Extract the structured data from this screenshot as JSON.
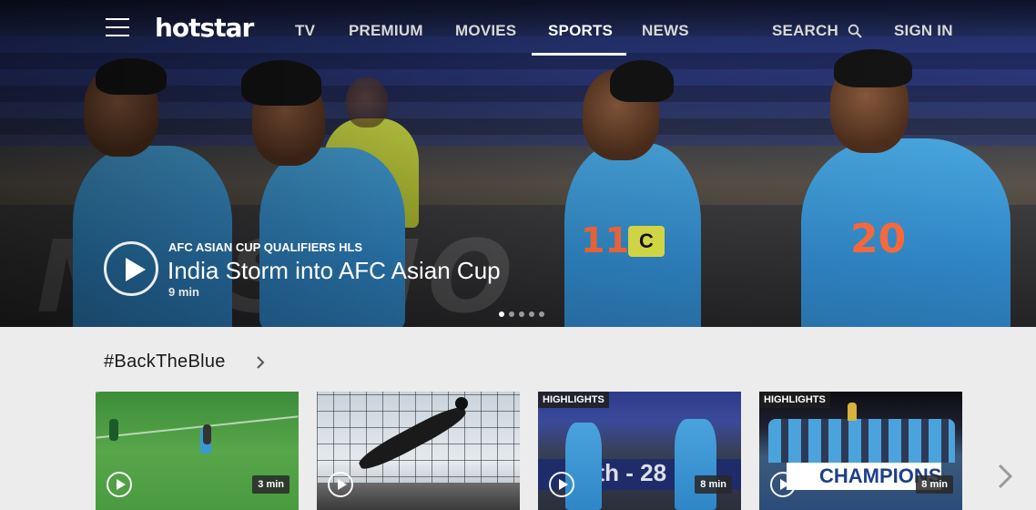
{
  "header": {
    "logo": "hotstar",
    "nav": [
      "TV",
      "PREMIUM",
      "MOVIES",
      "SPORTS",
      "NEWS"
    ],
    "active_nav": "SPORTS",
    "search_label": "SEARCH",
    "signin_label": "SIGN IN",
    "icons": [
      "hamburger-menu-icon",
      "search-icon"
    ]
  },
  "hero": {
    "kicker": "AFC ASIAN CUP QUALIFIERS HLS",
    "title": "India Storm into AFC Asian Cup",
    "duration": "9 min",
    "slide_count": 5,
    "active_slide": 1,
    "jersey_numbers": [
      "11",
      "20"
    ],
    "armband": "C"
  },
  "section": {
    "title": "#BackTheBlue",
    "cards": [
      {
        "badge": "",
        "duration": "3 min"
      },
      {
        "badge": "",
        "duration": ""
      },
      {
        "badge": "HIGHLIGHTS",
        "duration": "8 min",
        "scoreboard": "2th - 28"
      },
      {
        "badge": "HIGHLIGHTS",
        "duration": "8 min",
        "banner": "CHAMPIONS"
      }
    ]
  },
  "colors": {
    "accent": "#ffffff",
    "page_bg": "#ececec",
    "jersey_blue": "#3a97d6"
  }
}
